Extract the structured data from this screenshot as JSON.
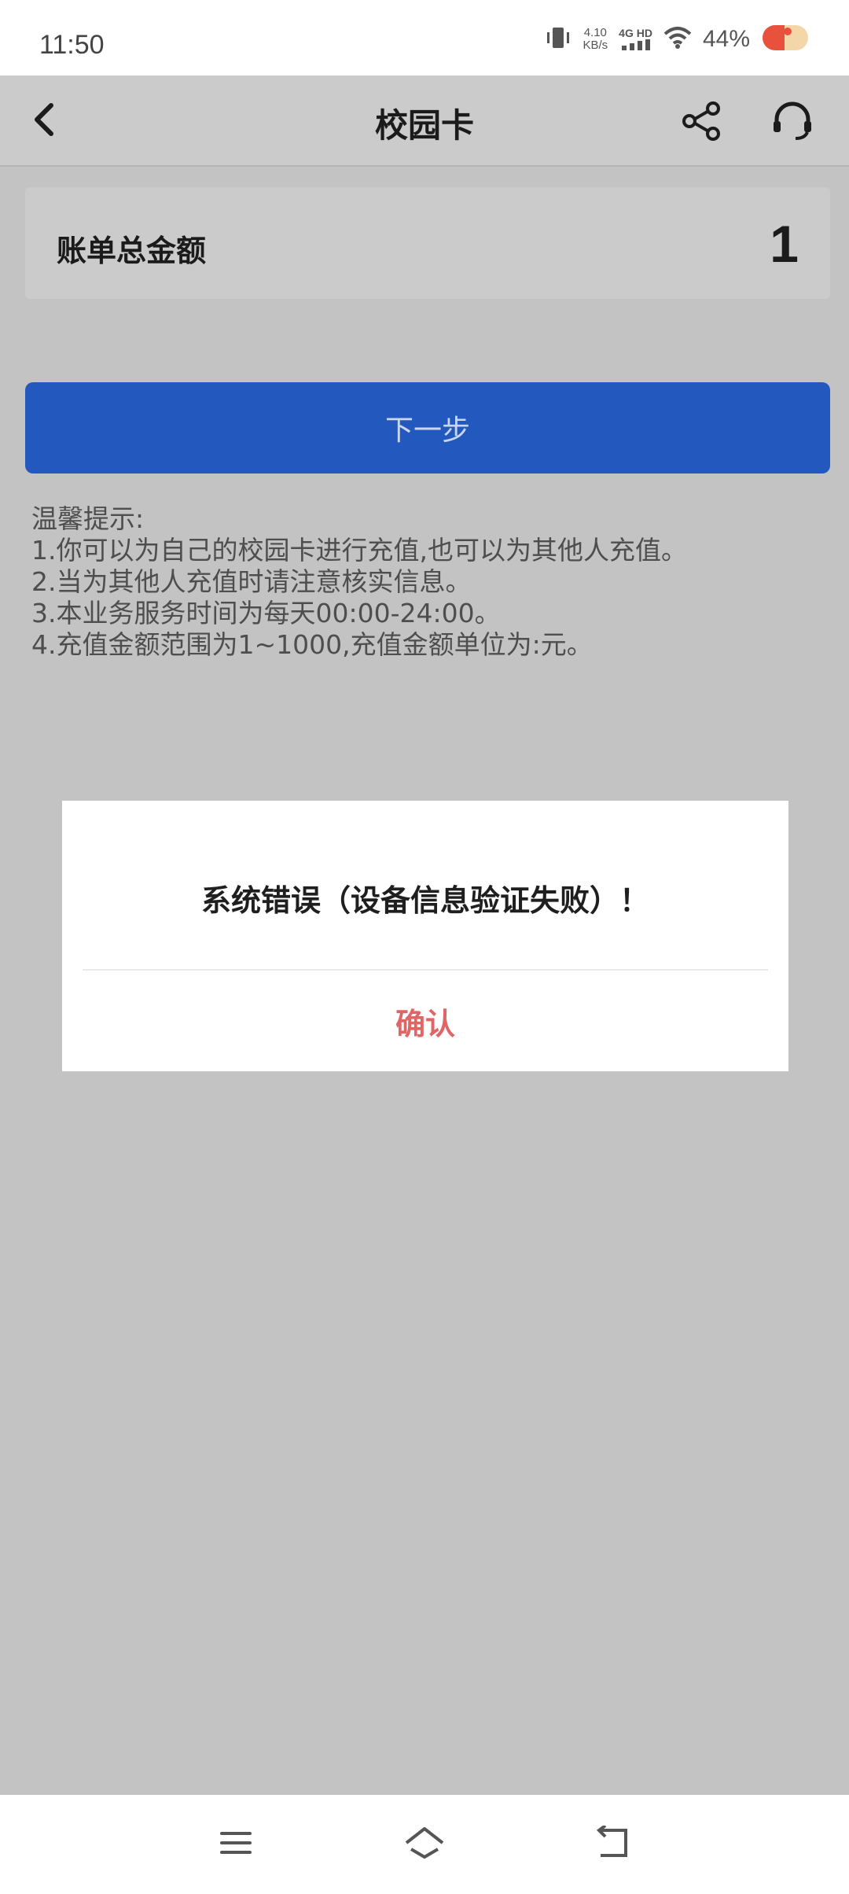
{
  "status_bar": {
    "time": "11:50",
    "net_speed_value": "4.10",
    "net_speed_unit": "KB/s",
    "network_type": "4G HD",
    "battery_percent": "44%",
    "icons": [
      "vibrate-icon",
      "signal-icon",
      "wifi-icon",
      "battery-icon"
    ]
  },
  "app_bar": {
    "title": "校园卡",
    "icons": [
      "back-arrow-icon",
      "share-icon",
      "headset-icon"
    ]
  },
  "bill": {
    "label": "账单总金额",
    "amount": "1"
  },
  "next_button": {
    "label": "下一步"
  },
  "tips": {
    "title": "温馨提示:",
    "items": [
      "1.你可以为自己的校园卡进行充值,也可以为其他人充值。",
      "2.当为其他人充值时请注意核实信息。",
      "3.本业务服务时间为每天00:00-24:00。",
      "4.充值金额范围为1~1000,充值金额单位为:元。"
    ]
  },
  "dialog": {
    "message": "系统错误（设备信息验证失败）！",
    "confirm_label": "确认"
  },
  "nav_bar": {
    "icons": [
      "menu-icon",
      "home-icon",
      "back-icon"
    ]
  },
  "colors": {
    "primary_button": "#2359bf",
    "confirm_text": "#e06565",
    "overlay_background": "#c3c3c3"
  }
}
